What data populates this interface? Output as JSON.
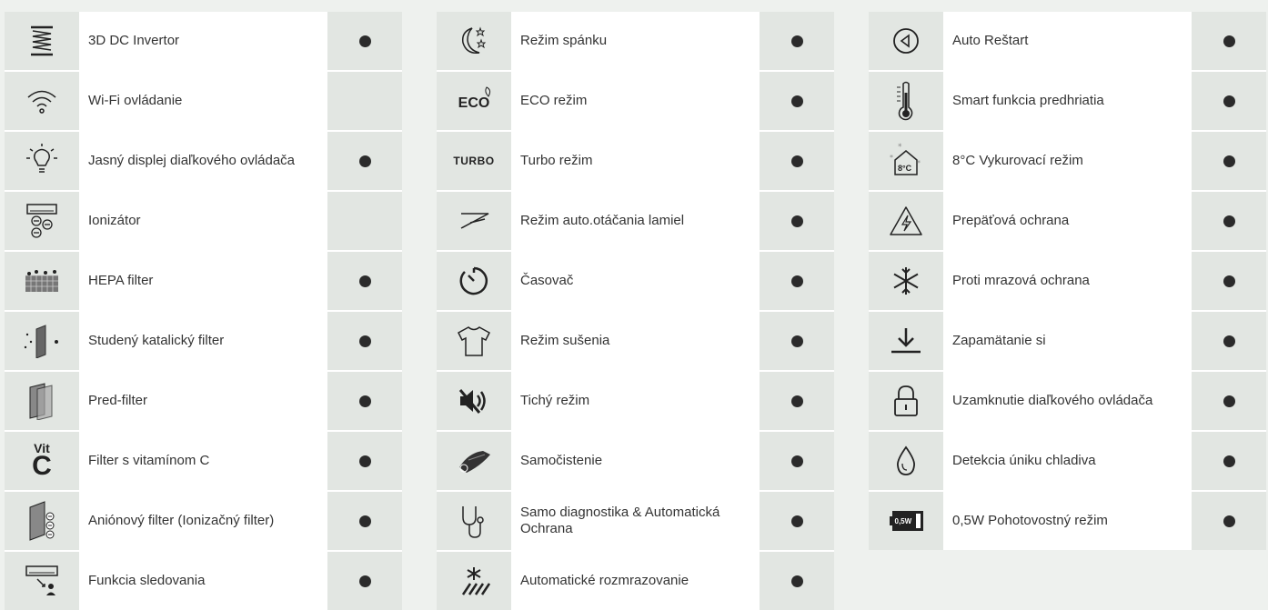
{
  "columns": [
    {
      "rows": [
        {
          "label": "3D DC Invertor",
          "icon": "inverter-coil-icon",
          "dot": true
        },
        {
          "label": "Wi-Fi ovládanie",
          "icon": "wifi-icon",
          "dot": false
        },
        {
          "label": "Jasný displej diaľkového ovládača",
          "icon": "lightbulb-icon",
          "dot": true
        },
        {
          "label": "Ionizátor",
          "icon": "ionizer-icon",
          "dot": false
        },
        {
          "label": "HEPA filter",
          "icon": "hepa-filter-icon",
          "dot": true
        },
        {
          "label": "Studený katalický filter",
          "icon": "catalyst-filter-icon",
          "dot": true
        },
        {
          "label": "Pred-filter",
          "icon": "pre-filter-icon",
          "dot": true
        },
        {
          "label": "Filter s vitamínom C",
          "icon": "vitamin-c-icon",
          "dot": true
        },
        {
          "label": "Aniónový filter (Ionizačný filter)",
          "icon": "anion-filter-icon",
          "dot": true
        },
        {
          "label": "Funkcia sledovania",
          "icon": "follow-me-icon",
          "dot": true
        }
      ]
    },
    {
      "rows": [
        {
          "label": "Režim spánku",
          "icon": "sleep-moon-icon",
          "dot": true
        },
        {
          "label": "ECO režim",
          "icon": "eco-icon",
          "dot": true
        },
        {
          "label": "Turbo režim",
          "icon": "turbo-icon",
          "dot": true
        },
        {
          "label": "Režim auto.otáčania lamiel",
          "icon": "louver-swing-icon",
          "dot": true
        },
        {
          "label": "Časovač",
          "icon": "timer-icon",
          "dot": true
        },
        {
          "label": "Režim sušenia",
          "icon": "shirt-icon",
          "dot": true
        },
        {
          "label": "Tichý režim",
          "icon": "mute-icon",
          "dot": true
        },
        {
          "label": "Samočistenie",
          "icon": "self-clean-icon",
          "dot": true
        },
        {
          "label": "Samo diagnostika & Automatická Ochrana",
          "icon": "stethoscope-icon",
          "dot": true
        },
        {
          "label": "Automatické rozmrazovanie",
          "icon": "defrost-icon",
          "dot": true
        }
      ]
    },
    {
      "rows": [
        {
          "label": "Auto Reštart",
          "icon": "auto-restart-icon",
          "dot": true
        },
        {
          "label": "Smart funkcia predhriatia",
          "icon": "thermometer-icon",
          "dot": true
        },
        {
          "label": "8°C Vykurovací režim",
          "icon": "house-8c-icon",
          "dot": true
        },
        {
          "label": "Prepäťová ochrana",
          "icon": "surge-warning-icon",
          "dot": true
        },
        {
          "label": "Proti mrazová ochrana",
          "icon": "snowflake-icon",
          "dot": true
        },
        {
          "label": "Zapamätanie si",
          "icon": "memory-download-icon",
          "dot": true
        },
        {
          "label": "Uzamknutie diaľkového ovládača",
          "icon": "lock-icon",
          "dot": true
        },
        {
          "label": "Detekcia úniku chladiva",
          "icon": "drop-icon",
          "dot": true
        },
        {
          "label": "0,5W Pohotovostný režim",
          "icon": "standby-battery-icon",
          "dot": true
        }
      ]
    }
  ],
  "icon_text": {
    "eco": "ECO",
    "turbo": "TURBO",
    "vit": "Vit",
    "c": "C",
    "eight": "8°C",
    "half_watt": "0,5W"
  }
}
